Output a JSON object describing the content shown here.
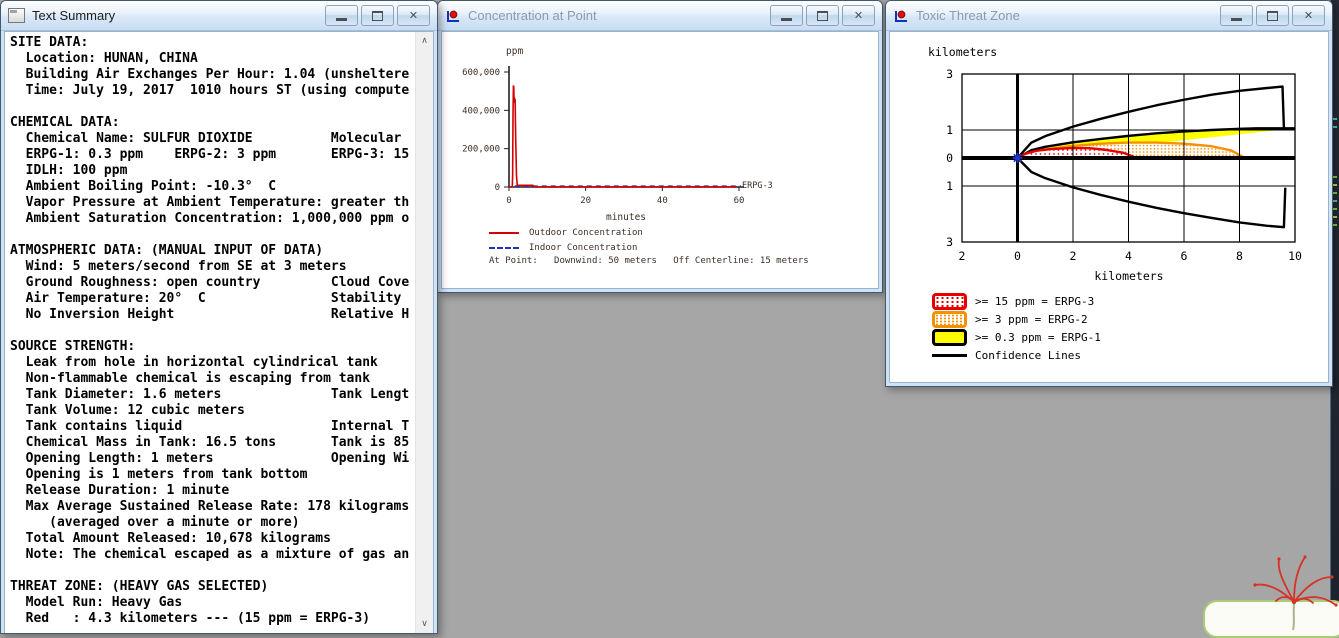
{
  "desktop": {
    "background": "#a6a6a6"
  },
  "windows": {
    "text_summary": {
      "title": "Text Summary",
      "lines": [
        "SITE DATA:",
        "  Location: HUNAN, CHINA",
        "  Building Air Exchanges Per Hour: 1.04 (unsheltere",
        "  Time: July 19, 2017  1010 hours ST (using compute",
        "",
        "CHEMICAL DATA:",
        "  Chemical Name: SULFUR DIOXIDE          Molecular",
        "  ERPG-1: 0.3 ppm    ERPG-2: 3 ppm       ERPG-3: 15",
        "  IDLH: 100 ppm",
        "  Ambient Boiling Point: -10.3°  C",
        "  Vapor Pressure at Ambient Temperature: greater th",
        "  Ambient Saturation Concentration: 1,000,000 ppm o",
        "",
        "ATMOSPHERIC DATA: (MANUAL INPUT OF DATA)",
        "  Wind: 5 meters/second from SE at 3 meters",
        "  Ground Roughness: open country         Cloud Cove",
        "  Air Temperature: 20°  C                Stability",
        "  No Inversion Height                    Relative H",
        "",
        "SOURCE STRENGTH:",
        "  Leak from hole in horizontal cylindrical tank",
        "  Non-flammable chemical is escaping from tank",
        "  Tank Diameter: 1.6 meters              Tank Lengt",
        "  Tank Volume: 12 cubic meters",
        "  Tank contains liquid                   Internal T",
        "  Chemical Mass in Tank: 16.5 tons       Tank is 85",
        "  Opening Length: 1 meters               Opening Wi",
        "  Opening is 1 meters from tank bottom",
        "  Release Duration: 1 minute",
        "  Max Average Sustained Release Rate: 178 kilograms",
        "     (averaged over a minute or more)",
        "  Total Amount Released: 10,678 kilograms",
        "  Note: The chemical escaped as a mixture of gas an",
        "",
        "THREAT ZONE: (HEAVY GAS SELECTED)",
        "  Model Run: Heavy Gas",
        "  Red   : 4.3 kilometers --- (15 ppm = ERPG-3)"
      ]
    },
    "concentration": {
      "title": "Concentration at Point"
    },
    "threat_zone": {
      "title": "Toxic Threat Zone"
    }
  },
  "chart_data": [
    {
      "type": "line",
      "title": "Concentration at Point",
      "ylabel": "ppm",
      "xlabel": "minutes",
      "xlim": [
        0,
        60
      ],
      "ylim": [
        0,
        600000
      ],
      "xticks": [
        0,
        20,
        40,
        60
      ],
      "yticks": [
        0,
        200000,
        400000,
        600000
      ],
      "ytick_labels": [
        "0",
        "200,000",
        "400,000",
        "600,000"
      ],
      "threshold_label": "ERPG-3",
      "grid": false,
      "legend_position": "below",
      "series": [
        {
          "name": "Outdoor Concentration",
          "color": "#d40000",
          "style": "solid",
          "points": [
            [
              0,
              500
            ],
            [
              0.85,
              500
            ],
            [
              0.95,
              60000
            ],
            [
              1.05,
              380000
            ],
            [
              1.15,
              530000
            ],
            [
              1.25,
              520000
            ],
            [
              1.32,
              440000
            ],
            [
              1.45,
              462000
            ],
            [
              1.6,
              455000
            ],
            [
              1.75,
              250000
            ],
            [
              1.95,
              60000
            ],
            [
              2.15,
              10000
            ],
            [
              2.4,
              9000
            ],
            [
              6.2,
              9000
            ],
            [
              6.7,
              1000
            ],
            [
              8,
              400
            ],
            [
              59.5,
              400
            ]
          ]
        },
        {
          "name": "Indoor Concentration",
          "color": "#2230bb",
          "style": "dashed",
          "points": [
            [
              1.5,
              4500
            ],
            [
              60.5,
              4500
            ]
          ]
        }
      ],
      "legend_note": "At Point:   Downwind: 50 meters   Off Centerline: 15 meters"
    },
    {
      "type": "threat-zone",
      "title": "Toxic Threat Zone",
      "ylabel": "kilometers",
      "xlabel": "kilometers",
      "xlim": [
        -2,
        10
      ],
      "ylim": [
        -3,
        3
      ],
      "xticks": [
        -2,
        0,
        2,
        4,
        6,
        8,
        10
      ],
      "xtick_labels": [
        "2",
        "0",
        "2",
        "4",
        "6",
        "8",
        "10"
      ],
      "yticks": [
        3,
        1,
        0,
        -1,
        -3
      ],
      "ytick_labels": [
        "3",
        "1",
        "0",
        "1",
        "3"
      ],
      "grid": true,
      "zones": [
        {
          "name": "ERPG-1 (>= 0.3 ppm)",
          "extent_km": 10,
          "color": "#ffff00",
          "outline": "#000000",
          "fill": "solid",
          "closed_at_right": true,
          "upper": [
            [
              0,
              0
            ],
            [
              0.5,
              0.28
            ],
            [
              1,
              0.4
            ],
            [
              2,
              0.56
            ],
            [
              3,
              0.68
            ],
            [
              4,
              0.79
            ],
            [
              5,
              0.88
            ],
            [
              6,
              0.95
            ],
            [
              7,
              1.0
            ],
            [
              8,
              1.04
            ],
            [
              8.6,
              1.06
            ],
            [
              10,
              1.06
            ]
          ]
        },
        {
          "name": "ERPG-2 (>= 3 ppm)",
          "extent_km": 8.2,
          "color": "#f59000",
          "outline": "#f59000",
          "fill": "dots",
          "upper": [
            [
              0,
              0
            ],
            [
              0.5,
              0.2
            ],
            [
              1,
              0.3
            ],
            [
              2,
              0.43
            ],
            [
              3,
              0.51
            ],
            [
              4,
              0.55
            ],
            [
              5,
              0.55
            ],
            [
              6,
              0.51
            ],
            [
              7,
              0.42
            ],
            [
              7.7,
              0.27
            ],
            [
              8.2,
              0
            ]
          ]
        },
        {
          "name": "ERPG-3 (>= 15 ppm)",
          "extent_km": 4.3,
          "color": "#e40000",
          "outline": "#e40000",
          "fill": "dots",
          "upper": [
            [
              0,
              0
            ],
            [
              0.3,
              0.16
            ],
            [
              0.7,
              0.26
            ],
            [
              1.2,
              0.32
            ],
            [
              2,
              0.36
            ],
            [
              2.6,
              0.35
            ],
            [
              3.2,
              0.29
            ],
            [
              3.8,
              0.19
            ],
            [
              4.3,
              0
            ]
          ]
        }
      ],
      "confidence": {
        "color": "#000000",
        "upper": [
          [
            0,
            0
          ],
          [
            0.5,
            0.55
          ],
          [
            1,
            0.78
          ],
          [
            2,
            1.12
          ],
          [
            3,
            1.4
          ],
          [
            4,
            1.65
          ],
          [
            5,
            1.88
          ],
          [
            6,
            2.08
          ],
          [
            7,
            2.26
          ],
          [
            8,
            2.4
          ],
          [
            9,
            2.5
          ],
          [
            9.55,
            2.55
          ],
          [
            9.6,
            1.06
          ]
        ],
        "lower": [
          [
            0,
            0
          ],
          [
            0.5,
            -0.5
          ],
          [
            1,
            -0.72
          ],
          [
            2,
            -1.05
          ],
          [
            3,
            -1.32
          ],
          [
            4,
            -1.56
          ],
          [
            5,
            -1.78
          ],
          [
            6,
            -1.97
          ],
          [
            7,
            -2.14
          ],
          [
            8,
            -2.3
          ],
          [
            9,
            -2.42
          ],
          [
            9.6,
            -2.47
          ],
          [
            9.65,
            -1.06
          ]
        ]
      },
      "origin_marker": {
        "color": "#2233cc"
      },
      "legend": [
        {
          "swatch": "red-dots",
          "label": ">= 15 ppm = ERPG-3"
        },
        {
          "swatch": "orange-dots",
          "label": ">= 3 ppm = ERPG-2"
        },
        {
          "swatch": "yellow-solid",
          "label": ">= 0.3 ppm = ERPG-1"
        },
        {
          "swatch": "line",
          "label": "Confidence Lines"
        }
      ]
    }
  ]
}
